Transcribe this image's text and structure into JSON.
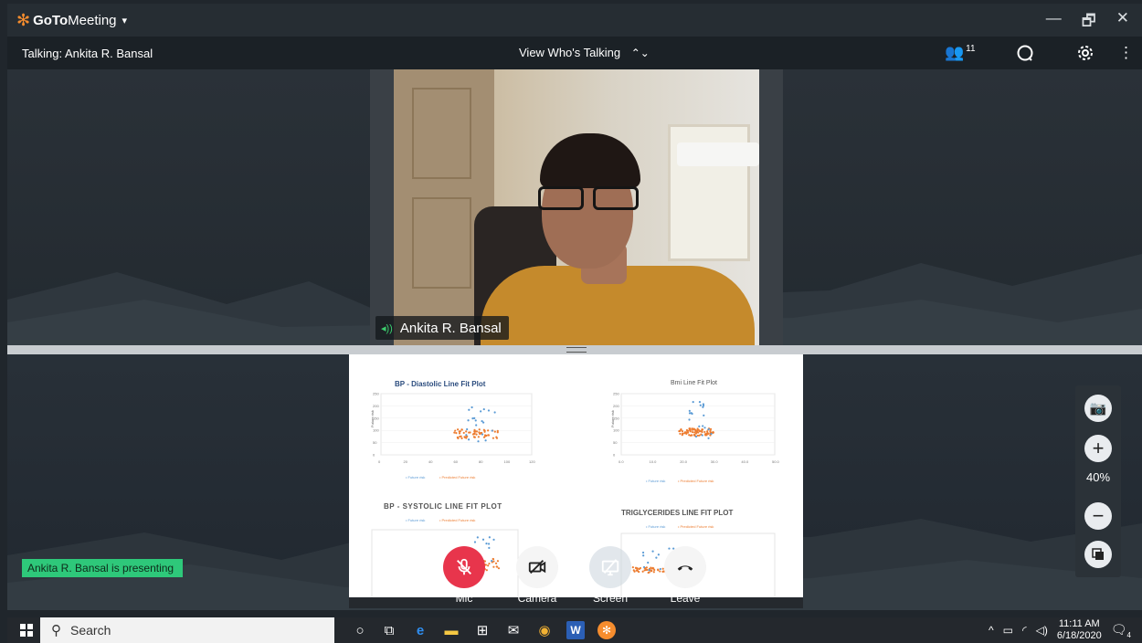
{
  "app": {
    "brand_goto": "GoTo",
    "brand_meeting": "Meeting",
    "caret": "▾"
  },
  "window": {
    "minimize": "—",
    "restore": "🗗",
    "close": "✕"
  },
  "talkbar": {
    "talking": "Talking: Ankita R. Bansal",
    "view_label": "View Who's Talking",
    "participant_count": "11"
  },
  "video": {
    "speaker_name": "Ankita R. Bansal"
  },
  "presenting_text": "Ankita R. Bansal is presenting",
  "slide": {
    "chart1_title": "BP - Diastolic Line Fit  Plot",
    "chart2_title": "Bmi Line Fit  Plot",
    "chart3_title": "BP - SYSTOLIC LINE FIT  PLOT",
    "chart4_title": "TRIGLYCERIDES LINE FIT  PLOT",
    "legend_actual": "Future risk",
    "legend_predicted": "Predicted Future risk",
    "ylabel": "Future risk",
    "chart1_xticks": [
      "0",
      "20",
      "40",
      "60",
      "80",
      "100",
      "120"
    ],
    "chart1_yticks": [
      "250",
      "200",
      "150",
      "100",
      "50",
      "0"
    ],
    "chart2_xticks": [
      "0.0",
      "10.0",
      "20.0",
      "30.0",
      "40.0",
      "50.0"
    ],
    "chart2_yticks": [
      "250",
      "200",
      "150",
      "100",
      "50",
      "0"
    ]
  },
  "controls": {
    "mic": "Mic",
    "camera": "Camera",
    "screen": "Screen",
    "leave": "Leave"
  },
  "zoom": {
    "percent": "40%",
    "plus": "+",
    "minus": "−"
  },
  "taskbar": {
    "search": "Search",
    "time": "11:11 AM",
    "date": "6/18/2020",
    "notif_count": "4"
  },
  "colors": {
    "accent_green": "#2ec87a",
    "mic_red": "#e8354c",
    "brand_orange": "#f68d2e",
    "series_actual": "#5b9bd5",
    "series_predicted": "#ed7d31"
  }
}
